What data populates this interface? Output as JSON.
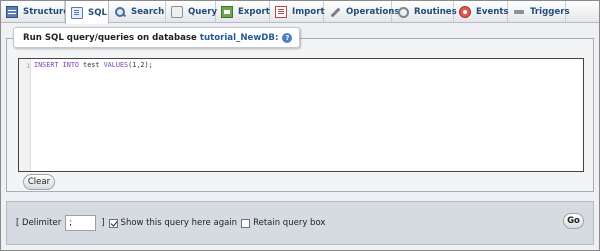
{
  "tabs": [
    {
      "label": "Structure",
      "icon": "structure-icon"
    },
    {
      "label": "SQL",
      "icon": "sql-icon",
      "active": true
    },
    {
      "label": "Search",
      "icon": "search-icon"
    },
    {
      "label": "Query",
      "icon": "query-icon"
    },
    {
      "label": "Export",
      "icon": "export-icon"
    },
    {
      "label": "Import",
      "icon": "import-icon"
    },
    {
      "label": "Operations",
      "icon": "operations-icon"
    },
    {
      "label": "Routines",
      "icon": "routines-icon"
    },
    {
      "label": "Events",
      "icon": "events-icon"
    },
    {
      "label": "Triggers",
      "icon": "triggers-icon"
    }
  ],
  "panel": {
    "legend_prefix": "Run SQL query/queries on database",
    "database": "tutorial_NewDB:",
    "help": "?"
  },
  "editor": {
    "line_number": "1",
    "keyword1": "INSERT",
    "keyword2": "INTO",
    "table": " test ",
    "keyword3": "VALUES",
    "rest": "(1,2);"
  },
  "buttons": {
    "clear": "Clear",
    "go": "Go"
  },
  "options": {
    "delimiter_label_open": "[ Delimiter",
    "delimiter_value": ";",
    "delimiter_label_close": "]",
    "show_query_label": "Show this query here again",
    "show_query_checked": true,
    "retain_label": "Retain query box",
    "retain_checked": false
  },
  "colors": {
    "tab_text": "#234d7a",
    "database_name": "#235a99",
    "sql_keyword": "#7a3fb8"
  }
}
